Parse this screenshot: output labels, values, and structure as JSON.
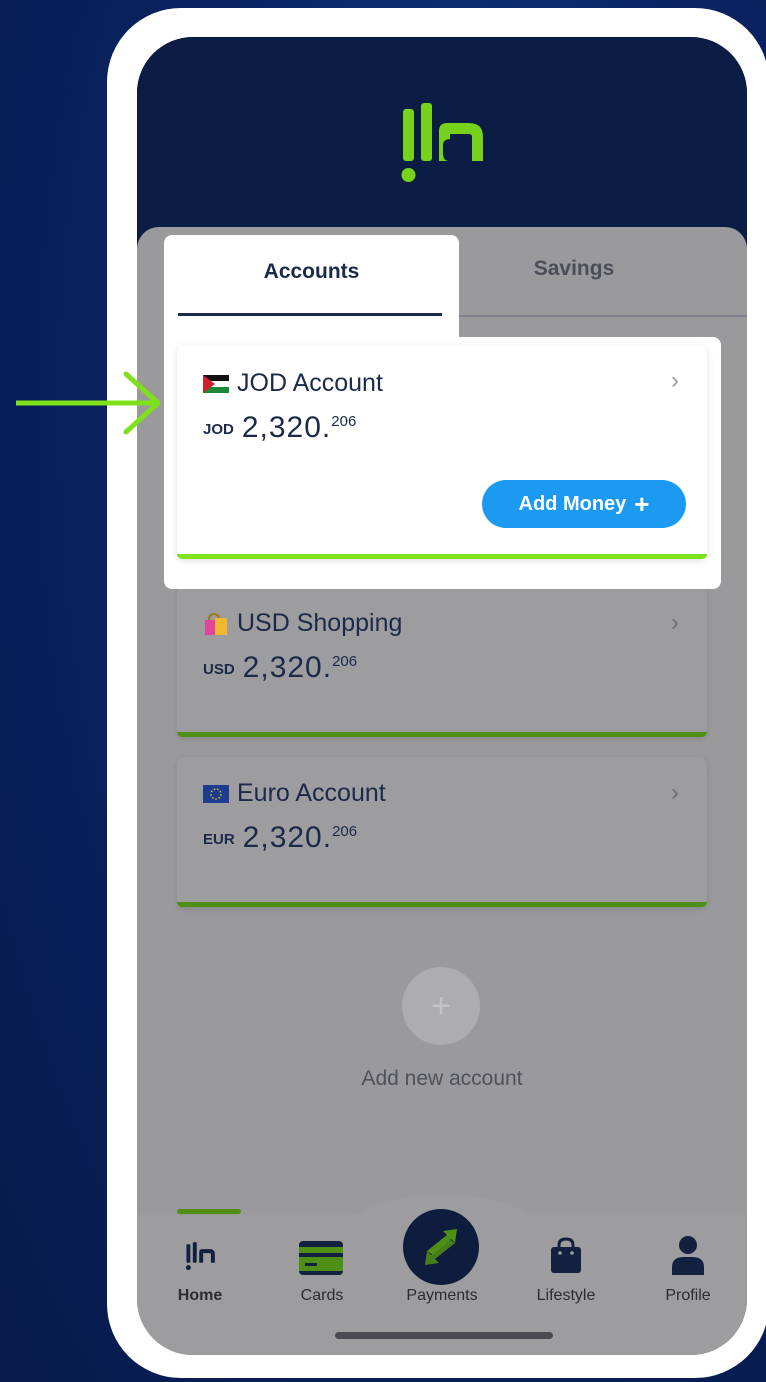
{
  "tabs": {
    "accounts": "Accounts",
    "savings": "Savings"
  },
  "accounts": [
    {
      "flag": "jordan-flag-icon",
      "name": "JOD Account",
      "currency": "JOD",
      "amount": "2,320.",
      "decimals": "206",
      "action": "Add Money"
    },
    {
      "flag": "shopping-bag-icon",
      "name": "USD Shopping",
      "currency": "USD",
      "amount": "2,320.",
      "decimals": "206"
    },
    {
      "flag": "eu-flag-icon",
      "name": "Euro Account",
      "currency": "EUR",
      "amount": "2,320.",
      "decimals": "206"
    }
  ],
  "add_account_label": "Add new account",
  "nav": [
    {
      "label": "Home",
      "icon": "ila-logo-icon",
      "active": true
    },
    {
      "label": "Cards",
      "icon": "card-icon"
    },
    {
      "label": "Payments",
      "icon": "transfer-arrows-icon"
    },
    {
      "label": "Lifestyle",
      "icon": "shopping-bag-icon"
    },
    {
      "label": "Profile",
      "icon": "person-icon"
    }
  ],
  "colors": {
    "brand_green": "#7ee21a",
    "navy": "#0b1d45",
    "button_blue": "#1c9af1"
  },
  "icons": {
    "chevron": "›",
    "plus": "+"
  }
}
